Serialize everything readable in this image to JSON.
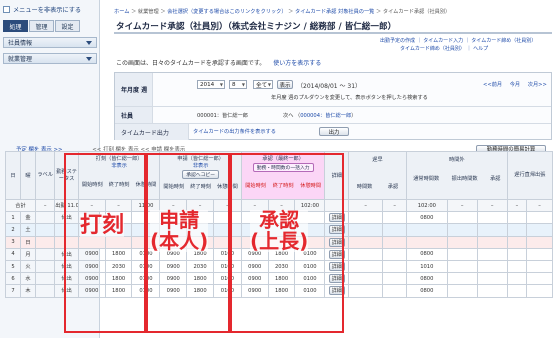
{
  "sidebar": {
    "toggle_label": "メニューを非表示にする",
    "tabs": [
      "処理",
      "管理",
      "設定"
    ],
    "menus": [
      "社員情報",
      "就業管理"
    ]
  },
  "breadcrumb": {
    "items": [
      "ホーム",
      "就業管理",
      "会社選択（変更する場合はこのリンクをクリック）",
      "タイムカード承認 対象社員の一覧",
      "タイムカード承認（社員別）"
    ]
  },
  "page": {
    "title": "タイムカード承認（社員別）（株式会社ミナジン / 総務部 / 皆仁総一郎）",
    "links": [
      "出勤予定の作成",
      "タイムカード入力",
      "タイムカード締め（社員別）"
    ],
    "links2": [
      "タイムカード締め（社員別）",
      "ヘルプ"
    ],
    "description": "この画面は、日々のタイムカードを承認する画面です。",
    "description_link": "使い方を表示する"
  },
  "form": {
    "period_label": "年月度 週",
    "year": "2014",
    "month": "8",
    "week": "全て",
    "display_button": "表示",
    "period_text": "（2014/08/01 ～ 31）",
    "period_hint": "年月度 週のプルダウンを変更して、表示ボタンを押したら検索する",
    "nav_prev": "<<前月",
    "nav_today": "今月",
    "nav_next": "次月>>",
    "employee_label": "社員",
    "employee_value": "000001：皆仁総一郎",
    "employee_next": "次へ",
    "employee_next_value": "000004：皆仁総一郎",
    "employee_suffix": "）",
    "output_label": "タイムカード出力",
    "output_link": "タイムカードの出力条件を表示する",
    "output_button": "出力"
  },
  "toolbar": {
    "text": "予定 欄を 表示 >>",
    "mid": "<< 打刻 欄を 表示   << 申請 欄を表示",
    "calc_button": "勤務時間の簡易計算"
  },
  "table": {
    "head": {
      "day": "日",
      "weekday": "曜",
      "label": "ラベル",
      "status": "勤務ステータス",
      "punch": "打刻（皆仁総一郎）",
      "punch_link": "非表示",
      "apply": "申請（皆仁総一郎）",
      "apply_link": "非表示",
      "apply_btn": "承認へコピー",
      "approve": "承認（最終一郎）",
      "approve_btn": "勤務・時間数の一括入力",
      "detail": "詳細",
      "late": "遅早",
      "overtime": "時間外",
      "legal_over": "通常時間数",
      "sub_cols": [
        "開始時刻",
        "終了時刻",
        "休憩時間"
      ],
      "hours": "時間数",
      "approve_small": "承認",
      "normal_hours": "通常時間数",
      "transfer": "振出時間数",
      "holiday": "遅行直帰出張",
      "absence": "欠勤時間数"
    },
    "total": {
      "label": "合計",
      "status": "出勤 11.0",
      "punch_break": "11:00",
      "approve_break": "102:00",
      "normal": "102:00"
    },
    "rows": [
      {
        "day": "1",
        "wd": "金",
        "status": "休出",
        "p": [
          "",
          "",
          ""
        ],
        "a": [
          "",
          "",
          ""
        ],
        "b": [
          "",
          "",
          ""
        ],
        "ot": "0800",
        "cls": ""
      },
      {
        "day": "2",
        "wd": "土",
        "status": "",
        "p": [
          "",
          "",
          ""
        ],
        "a": [
          "",
          "",
          ""
        ],
        "b": [
          "",
          "",
          ""
        ],
        "ot": "",
        "cls": "sat"
      },
      {
        "day": "3",
        "wd": "日",
        "status": "",
        "p": [
          "",
          "",
          ""
        ],
        "a": [
          "",
          "",
          ""
        ],
        "b": [
          "",
          "",
          ""
        ],
        "ot": "",
        "cls": "sun"
      },
      {
        "day": "4",
        "wd": "月",
        "status": "休出",
        "p": [
          "0900",
          "1800",
          "0100"
        ],
        "a": [
          "0900",
          "1800",
          "0100"
        ],
        "b": [
          "0900",
          "1800",
          "0100"
        ],
        "ot": "0800",
        "cls": ""
      },
      {
        "day": "5",
        "wd": "火",
        "status": "休出",
        "p": [
          "0900",
          "2030",
          "0100"
        ],
        "a": [
          "0900",
          "2030",
          "0100"
        ],
        "b": [
          "0900",
          "2030",
          "0100"
        ],
        "ot": "1010",
        "cls": ""
      },
      {
        "day": "6",
        "wd": "水",
        "status": "休出",
        "p": [
          "0900",
          "1800",
          "0100"
        ],
        "a": [
          "0900",
          "1800",
          "0100"
        ],
        "b": [
          "0900",
          "1800",
          "0100"
        ],
        "ot": "0800",
        "cls": ""
      },
      {
        "day": "7",
        "wd": "木",
        "status": "休出",
        "p": [
          "0900",
          "1800",
          "0100"
        ],
        "a": [
          "0900",
          "1800",
          "0100"
        ],
        "b": [
          "0900",
          "1800",
          "0100"
        ],
        "ot": "0800",
        "cls": ""
      }
    ],
    "detail_label": "詳細"
  },
  "overlays": {
    "punch": "打刻",
    "apply": "申請\n(本人)",
    "approve": "承認\n(上長)"
  },
  "colors": {
    "accent_red": "#e4282e",
    "link_blue": "#1c49a8",
    "approve_pink": "#fbd6f6"
  }
}
